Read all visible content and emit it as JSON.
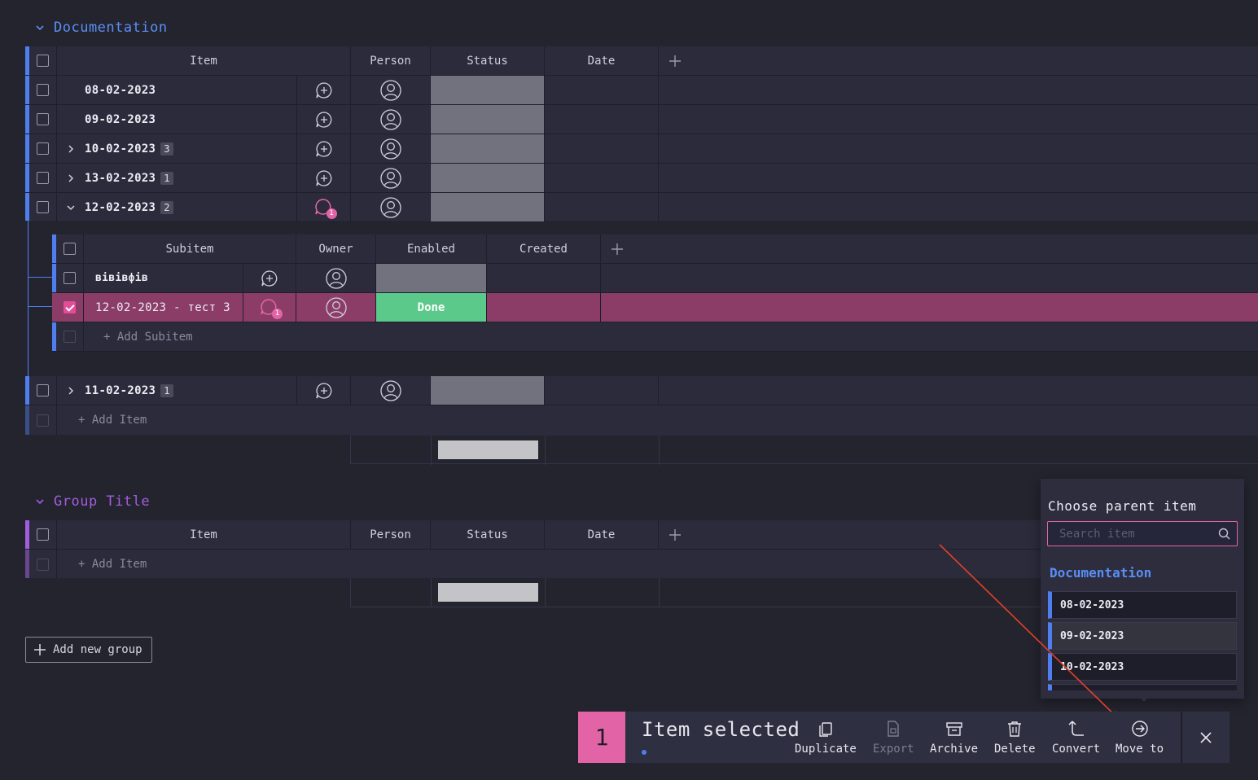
{
  "groups": [
    {
      "title": "Documentation",
      "color": "#5b8ef5",
      "columns": {
        "item": "Item",
        "person": "Person",
        "status": "Status",
        "date": "Date"
      },
      "items": [
        {
          "name": "08-02-2023",
          "subitems": "",
          "expand": "none"
        },
        {
          "name": "09-02-2023",
          "subitems": "",
          "expand": "none"
        },
        {
          "name": "10-02-2023",
          "subitems": "3",
          "expand": "collapsed"
        },
        {
          "name": "13-02-2023",
          "subitems": "1",
          "expand": "collapsed"
        },
        {
          "name": "12-02-2023",
          "subitems": "2",
          "expand": "expanded",
          "comment_count": "1"
        },
        {
          "name": "11-02-2023",
          "subitems": "1",
          "expand": "collapsed"
        }
      ],
      "subtable": {
        "columns": {
          "subitem": "Subitem",
          "owner": "Owner",
          "enabled": "Enabled",
          "created": "Created"
        },
        "rows": [
          {
            "name": "вівівфів",
            "enabled": ""
          },
          {
            "name": "12-02-2023 - тест 3",
            "enabled": "Done",
            "comment_count": "1",
            "selected": true
          }
        ],
        "add_label": "+ Add Subitem"
      },
      "add_label": "+ Add Item"
    },
    {
      "title": "Group Title",
      "color": "#a25ddc",
      "columns": {
        "item": "Item",
        "person": "Person",
        "status": "Status",
        "date": "Date"
      },
      "add_label": "+ Add Item"
    }
  ],
  "add_group_label": "Add new group",
  "popup": {
    "title": "Choose parent item",
    "search_placeholder": "Search item",
    "group": "Documentation",
    "items": [
      "08-02-2023",
      "09-02-2023",
      "10-02-2023"
    ]
  },
  "action_bar": {
    "count": "1",
    "selected_label": "Item selected",
    "actions": [
      {
        "label": "Duplicate",
        "icon": "duplicate-icon",
        "enabled": true
      },
      {
        "label": "Export",
        "icon": "export-icon",
        "enabled": false
      },
      {
        "label": "Archive",
        "icon": "archive-icon",
        "enabled": true
      },
      {
        "label": "Delete",
        "icon": "trash-icon",
        "enabled": true
      },
      {
        "label": "Convert",
        "icon": "convert-icon",
        "enabled": true
      },
      {
        "label": "Move to",
        "icon": "move-to-icon",
        "enabled": true
      }
    ]
  },
  "colors": {
    "done": "#5bc98a",
    "selected_row": "#8b3d68",
    "accent_pink": "#e364a6"
  }
}
